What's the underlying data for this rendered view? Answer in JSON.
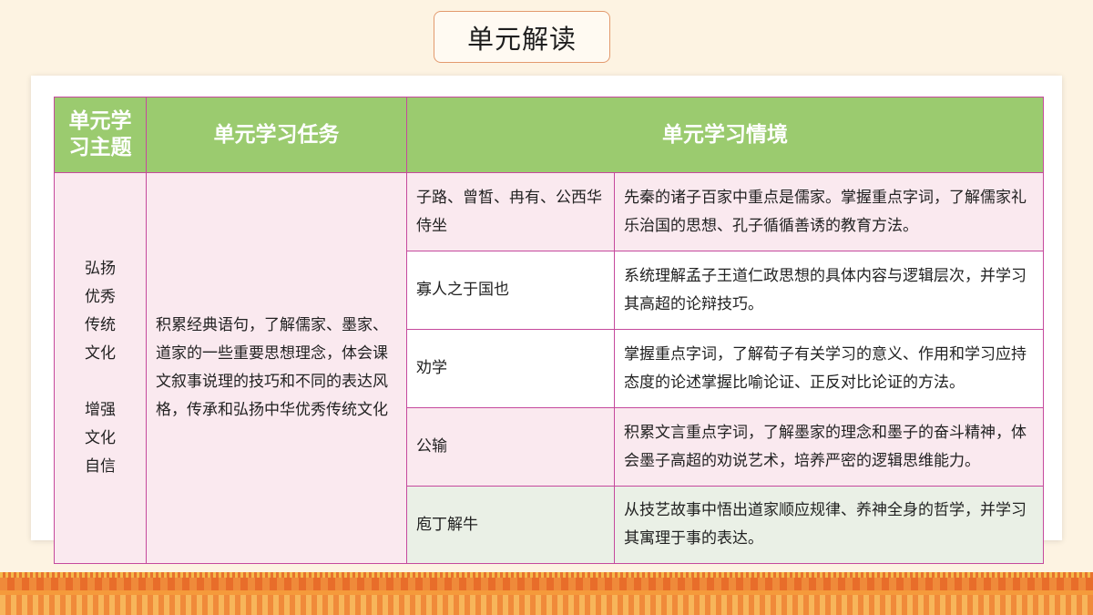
{
  "page": {
    "title": "单元解读"
  },
  "table": {
    "headers": {
      "theme": "单元学习主题",
      "task": "单元学习任务",
      "situation": "单元学习情境"
    },
    "theme_lines_1": [
      "弘扬",
      "优秀",
      "传统",
      "文化"
    ],
    "theme_lines_2": [
      "增强",
      "文化",
      "自信"
    ],
    "task": "积累经典语句，了解儒家、墨家、道家的一些重要思想理念，体会课文叙事说理的技巧和不同的表达风格，传承和弘扬中华优秀传统文化",
    "rows": [
      {
        "lesson": "子路、曾皙、冉有、公西华侍坐",
        "desc": "先秦的诸子百家中重点是儒家。掌握重点字词，了解儒家礼乐治国的思想、孔子循循善诱的教育方法。"
      },
      {
        "lesson": "寡人之于国也",
        "desc": "系统理解孟子王道仁政思想的具体内容与逻辑层次，并学习其高超的论辩技巧。"
      },
      {
        "lesson": "劝学",
        "desc": "掌握重点字词，了解荀子有关学习的意义、作用和学习应持态度的论述掌握比喻论证、正反对比论证的方法。"
      },
      {
        "lesson": "公输",
        "desc": "积累文言重点字词，了解墨家的理念和墨子的奋斗精神，体会墨子高超的劝说艺术，培养严密的逻辑思维能力。"
      },
      {
        "lesson": "庖丁解牛",
        "desc": "从技艺故事中悟出道家顺应规律、养神全身的哲学，并学习其寓理于事的表达。"
      }
    ]
  }
}
